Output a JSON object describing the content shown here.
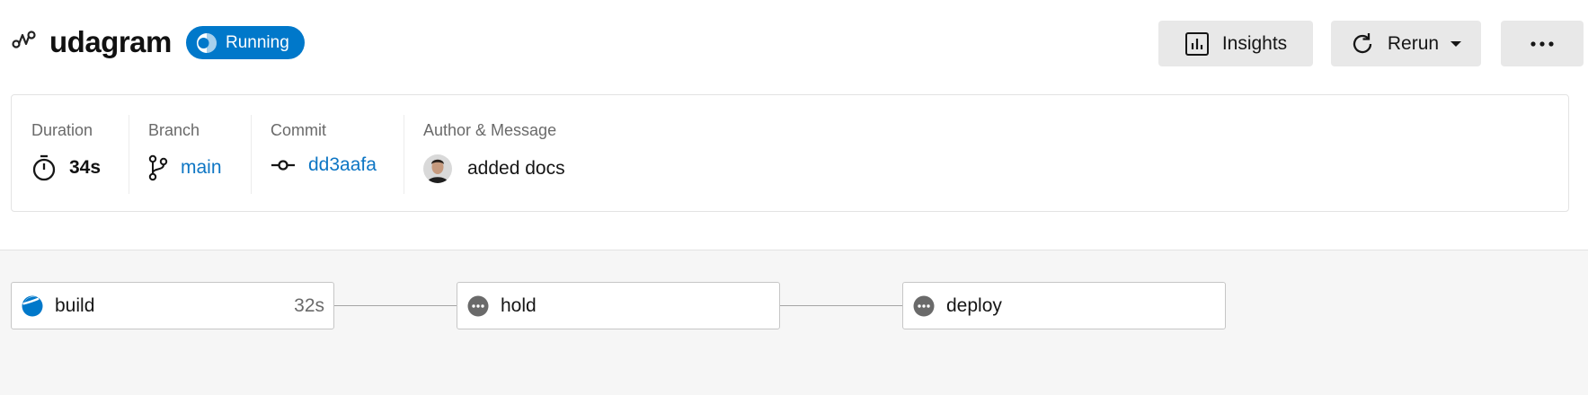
{
  "header": {
    "project_name": "udagram",
    "status": "Running",
    "status_color": "#0078ca",
    "workflow_icon": "workflow-icon"
  },
  "actions": {
    "insights_label": "Insights",
    "rerun_label": "Rerun",
    "more_icon": "more-horizontal-icon"
  },
  "info": {
    "duration": {
      "label": "Duration",
      "value": "34s",
      "icon": "stopwatch-icon"
    },
    "branch": {
      "label": "Branch",
      "value": "main",
      "icon": "branch-icon"
    },
    "commit": {
      "label": "Commit",
      "value": "dd3aafa",
      "icon": "commit-icon"
    },
    "author": {
      "label": "Author & Message",
      "message": "added docs",
      "icon": "avatar"
    }
  },
  "pipeline": {
    "jobs": [
      {
        "name": "build",
        "duration": "32s",
        "status": "running",
        "icon": "running-icon"
      },
      {
        "name": "hold",
        "duration": "",
        "status": "pending",
        "icon": "pending-icon"
      },
      {
        "name": "deploy",
        "duration": "",
        "status": "pending",
        "icon": "pending-icon"
      }
    ]
  },
  "colors": {
    "accent": "#0078ca",
    "link": "#0e76c4",
    "pending": "#6a6a6a"
  }
}
